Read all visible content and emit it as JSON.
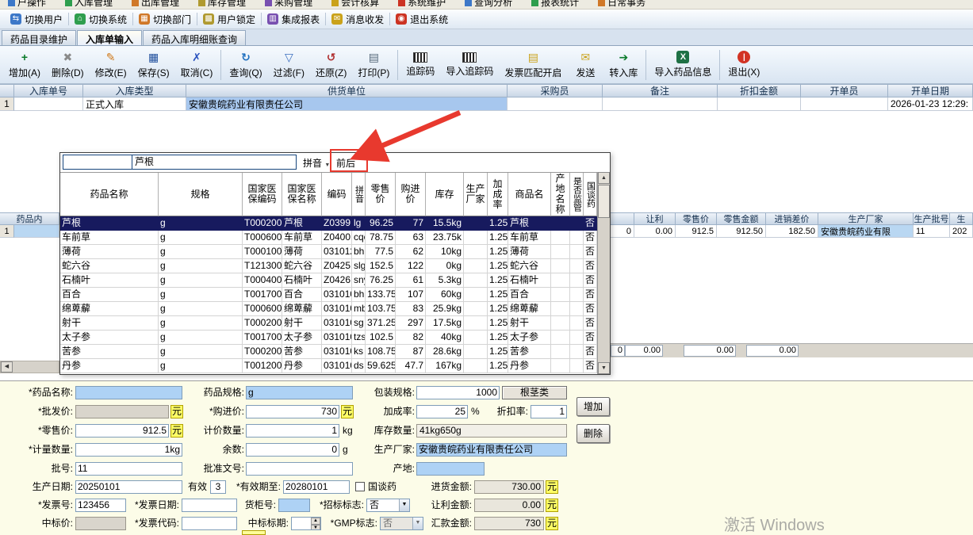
{
  "menu_bar": {
    "items": [
      "户操作",
      "入库管理",
      "出库管理",
      "库存管理",
      "采购管理",
      "会计核算",
      "系统维护",
      "查询分析",
      "报表统计",
      "日常事务"
    ]
  },
  "quick_bar": {
    "items": [
      "切换用户",
      "切换系统",
      "切换部门",
      "用户锁定",
      "集成报表",
      "消息收发",
      "退出系统"
    ]
  },
  "tab_bar": {
    "tabs": [
      "药品目录维护",
      "入库单输入",
      "药品入库明细账查询"
    ],
    "active_index": 1
  },
  "toolbar": {
    "buttons": [
      {
        "label": "增加(A)",
        "icon": "add"
      },
      {
        "label": "删除(D)",
        "icon": "delete"
      },
      {
        "label": "修改(E)",
        "icon": "edit"
      },
      {
        "label": "保存(S)",
        "icon": "save"
      },
      {
        "label": "取消(C)",
        "icon": "cancel",
        "sep": true
      },
      {
        "label": "查询(Q)",
        "icon": "query"
      },
      {
        "label": "过滤(F)",
        "icon": "filter"
      },
      {
        "label": "还原(Z)",
        "icon": "restore"
      },
      {
        "label": "打印(P)",
        "icon": "print",
        "sep": true
      },
      {
        "label": "追踪码",
        "icon": "barcode"
      },
      {
        "label": "导入追踪码",
        "icon": "barcode-import"
      },
      {
        "label": "发票匹配开启",
        "icon": "invoice"
      },
      {
        "label": "发送",
        "icon": "send"
      },
      {
        "label": "转入库",
        "icon": "transfer",
        "sep": true
      },
      {
        "label": "导入药品信息",
        "icon": "excel",
        "sep": true
      },
      {
        "label": "退出(X)",
        "icon": "exit"
      }
    ]
  },
  "order_grid": {
    "headers": [
      "入库单号",
      "入库类型",
      "供货单位",
      "采购员",
      "备注",
      "折扣金额",
      "开单员",
      "开单日期"
    ],
    "row": [
      "1",
      "",
      "正式入库",
      "安徽贵皖药业有限责任公司",
      "",
      "",
      "",
      "",
      "2026-01-23 12:29:"
    ]
  },
  "popup": {
    "search_value": "",
    "keyword": "芦根",
    "pinyin_label": "拼音",
    "mode_label": "前后",
    "headers": [
      "药品名称",
      "规格",
      "国家医保编码",
      "国家医保名称",
      "编码",
      "拼音",
      "零售价",
      "购进价",
      "库存",
      "生产厂家",
      "加成率",
      "商品名",
      "产地名称",
      "是否监管",
      "国谈药"
    ],
    "selected_index": 0,
    "rows": [
      [
        "芦根",
        "g",
        "T000200",
        "芦根",
        "Z0399",
        "lg",
        "96.25",
        "77",
        "15.5kg",
        "",
        "1.25",
        "芦根",
        "",
        "",
        "否"
      ],
      [
        "车前草",
        "g",
        "T000600",
        "车前草",
        "Z0400",
        "cqc",
        "78.75",
        "63",
        "23.75k",
        "",
        "1.25",
        "车前草",
        "",
        "",
        "否"
      ],
      [
        "薄荷",
        "g",
        "T000100",
        "薄荷",
        "031012",
        "bh",
        "77.5",
        "62",
        "10kg",
        "",
        "1.25",
        "薄荷",
        "",
        "",
        "否"
      ],
      [
        "蛇六谷",
        "g",
        "T121300",
        "蛇六谷",
        "Z0425",
        "slg",
        "152.5",
        "122",
        "0kg",
        "",
        "1.25",
        "蛇六谷",
        "",
        "",
        "否"
      ],
      [
        "石楠叶",
        "g",
        "T000400",
        "石楠叶",
        "Z0426",
        "sny",
        "76.25",
        "61",
        "5.3kg",
        "",
        "1.25",
        "石楠叶",
        "",
        "",
        "否"
      ],
      [
        "百合",
        "g",
        "T001700",
        "百合",
        "031010",
        "bh",
        "133.75",
        "107",
        "60kg",
        "",
        "1.25",
        "百合",
        "",
        "",
        "否"
      ],
      [
        "绵萆薢",
        "g",
        "T000600",
        "绵萆薢",
        "031010",
        "mb",
        "103.75",
        "83",
        "25.9kg",
        "",
        "1.25",
        "绵萆薢",
        "",
        "",
        "否"
      ],
      [
        "射干",
        "g",
        "T000200",
        "射干",
        "031010",
        "sg",
        "371.25",
        "297",
        "17.5kg",
        "",
        "1.25",
        "射干",
        "",
        "",
        "否"
      ],
      [
        "太子参",
        "g",
        "T001700",
        "太子参",
        "031010",
        "tzs",
        "102.5",
        "82",
        "40kg",
        "",
        "1.25",
        "太子参",
        "",
        "",
        "否"
      ],
      [
        "苦参",
        "g",
        "T000200",
        "苦参",
        "031010",
        "ks",
        "108.75",
        "87",
        "28.6kg",
        "",
        "1.25",
        "苦参",
        "",
        "",
        "否"
      ],
      [
        "丹参",
        "g",
        "T001200",
        "丹参",
        "031010",
        "ds",
        "59.625",
        "47.7",
        "167kg",
        "",
        "1.25",
        "丹参",
        "",
        "",
        "否"
      ]
    ]
  },
  "detail_grid": {
    "left_header": "药品内",
    "left_row_no": "1",
    "right_headers": [
      "",
      "让利",
      "零售价",
      "零售金额",
      "进销差价",
      "生产厂家",
      "生产批号",
      "生"
    ],
    "right_row": [
      "0",
      "0.00",
      "912.5",
      "912.50",
      "182.50",
      "安徽贵皖药业有限",
      "11",
      "202"
    ],
    "totals": [
      "0",
      "0.00",
      "0.00",
      "0.00"
    ]
  },
  "form": {
    "drug_name": {
      "label": "*药品名称:",
      "value": ""
    },
    "spec": {
      "label": "药品规格:",
      "value": "g"
    },
    "pack_spec": {
      "label": "包装规格:",
      "value": "1000",
      "tag": "根茎类"
    },
    "wholesale_price": {
      "label": "*批发价:",
      "value": "",
      "unit": "元"
    },
    "purchase_price": {
      "label": "*购进价:",
      "value": "730",
      "unit": "元"
    },
    "markup_rate": {
      "label": "加成率:",
      "value": "25",
      "unit": "%"
    },
    "discount_rate": {
      "label": "折扣率:",
      "value": "1"
    },
    "retail_price": {
      "label": "*零售价:",
      "value": "912.5",
      "unit": "元"
    },
    "pricing_qty": {
      "label": "计价数量:",
      "value": "1",
      "unit": "kg"
    },
    "stock_qty": {
      "label": "库存数量:",
      "value": "41kg650g"
    },
    "measure_qty": {
      "label": "*计量数量:",
      "value": "1kg"
    },
    "remainder": {
      "label": "余数:",
      "value": "0",
      "unit": "g"
    },
    "manufacturer": {
      "label": "生产厂家:",
      "value": "安徽贵皖药业有限责任公司"
    },
    "batch_no": {
      "label": "批号:",
      "value": "11"
    },
    "approval_no": {
      "label": "批准文号:",
      "value": ""
    },
    "origin": {
      "label": "产地:",
      "value": ""
    },
    "production_date": {
      "label": "生产日期:",
      "value": "20250101"
    },
    "valid_years": {
      "label": "有效",
      "value": "3"
    },
    "expiry_date": {
      "label": "*有效期至:",
      "value": "20280101"
    },
    "national_talk": {
      "label": "国谈药"
    },
    "purchase_amount": {
      "label": "进货金额:",
      "value": "730.00",
      "unit": "元"
    },
    "invoice_no": {
      "label": "*发票号:",
      "value": "123456"
    },
    "invoice_date": {
      "label": "*发票日期:",
      "value": ""
    },
    "cabinet_no": {
      "label": "货柜号:",
      "value": ""
    },
    "bid_flag": {
      "label": "*招标标志:",
      "value": "否"
    },
    "rebate_amount": {
      "label": "让利金额:",
      "value": "0.00",
      "unit": "元"
    },
    "bid_price": {
      "label": "中标价:",
      "value": ""
    },
    "invoice_code": {
      "label": "*发票代码:",
      "value": ""
    },
    "bid_period": {
      "label": "中标标期:",
      "value": ""
    },
    "gmp_flag": {
      "label": "*GMP标志:",
      "value": "否"
    },
    "remit_amount": {
      "label": "汇款金额:",
      "value": "730",
      "unit": "元"
    },
    "add_button": "增加",
    "delete_button": "删除"
  },
  "watermark": "激活 Windows"
}
